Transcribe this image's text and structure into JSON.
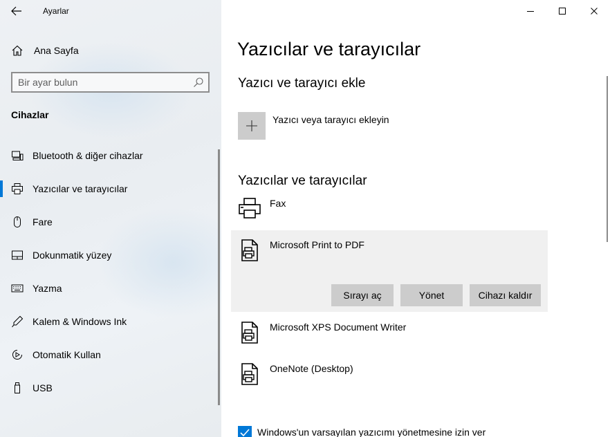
{
  "window": {
    "title": "Ayarlar",
    "controls": [
      "minimize",
      "maximize",
      "close"
    ]
  },
  "sidebar": {
    "home_label": "Ana Sayfa",
    "search_placeholder": "Bir ayar bulun",
    "section_title": "Cihazlar",
    "items": [
      {
        "label": "Bluetooth & diğer cihazlar",
        "icon": "bluetooth-devices-icon",
        "active": false
      },
      {
        "label": "Yazıcılar ve tarayıcılar",
        "icon": "printer-icon",
        "active": true
      },
      {
        "label": "Fare",
        "icon": "mouse-icon",
        "active": false
      },
      {
        "label": "Dokunmatik yüzey",
        "icon": "touchpad-icon",
        "active": false
      },
      {
        "label": "Yazma",
        "icon": "keyboard-icon",
        "active": false
      },
      {
        "label": "Kalem & Windows Ink",
        "icon": "pen-icon",
        "active": false
      },
      {
        "label": "Otomatik Kullan",
        "icon": "autoplay-icon",
        "active": false
      },
      {
        "label": "USB",
        "icon": "usb-icon",
        "active": false
      }
    ]
  },
  "main": {
    "page_title": "Yazıcılar ve tarayıcılar",
    "add_section_title": "Yazıcı ve tarayıcı ekle",
    "add_label": "Yazıcı veya tarayıcı ekleyin",
    "list_section_title": "Yazıcılar ve tarayıcılar",
    "printers": [
      {
        "name": "Fax",
        "icon": "fax-printer-icon",
        "selected": false
      },
      {
        "name": "Microsoft Print to PDF",
        "icon": "document-printer-icon",
        "selected": true
      },
      {
        "name": "Microsoft XPS Document Writer",
        "icon": "document-printer-icon",
        "selected": false
      },
      {
        "name": "OneNote (Desktop)",
        "icon": "document-printer-icon",
        "selected": false
      }
    ],
    "actions": {
      "open_queue": "Sırayı aç",
      "manage": "Yönet",
      "remove": "Cihazı kaldır"
    },
    "default_checkbox": {
      "label": "Windows'un varsayılan yazıcımı yönetmesine izin ver",
      "checked": true
    }
  },
  "colors": {
    "accent": "#0078d7",
    "button_bg": "#cccccc",
    "selected_bg": "#f0f0f0"
  }
}
